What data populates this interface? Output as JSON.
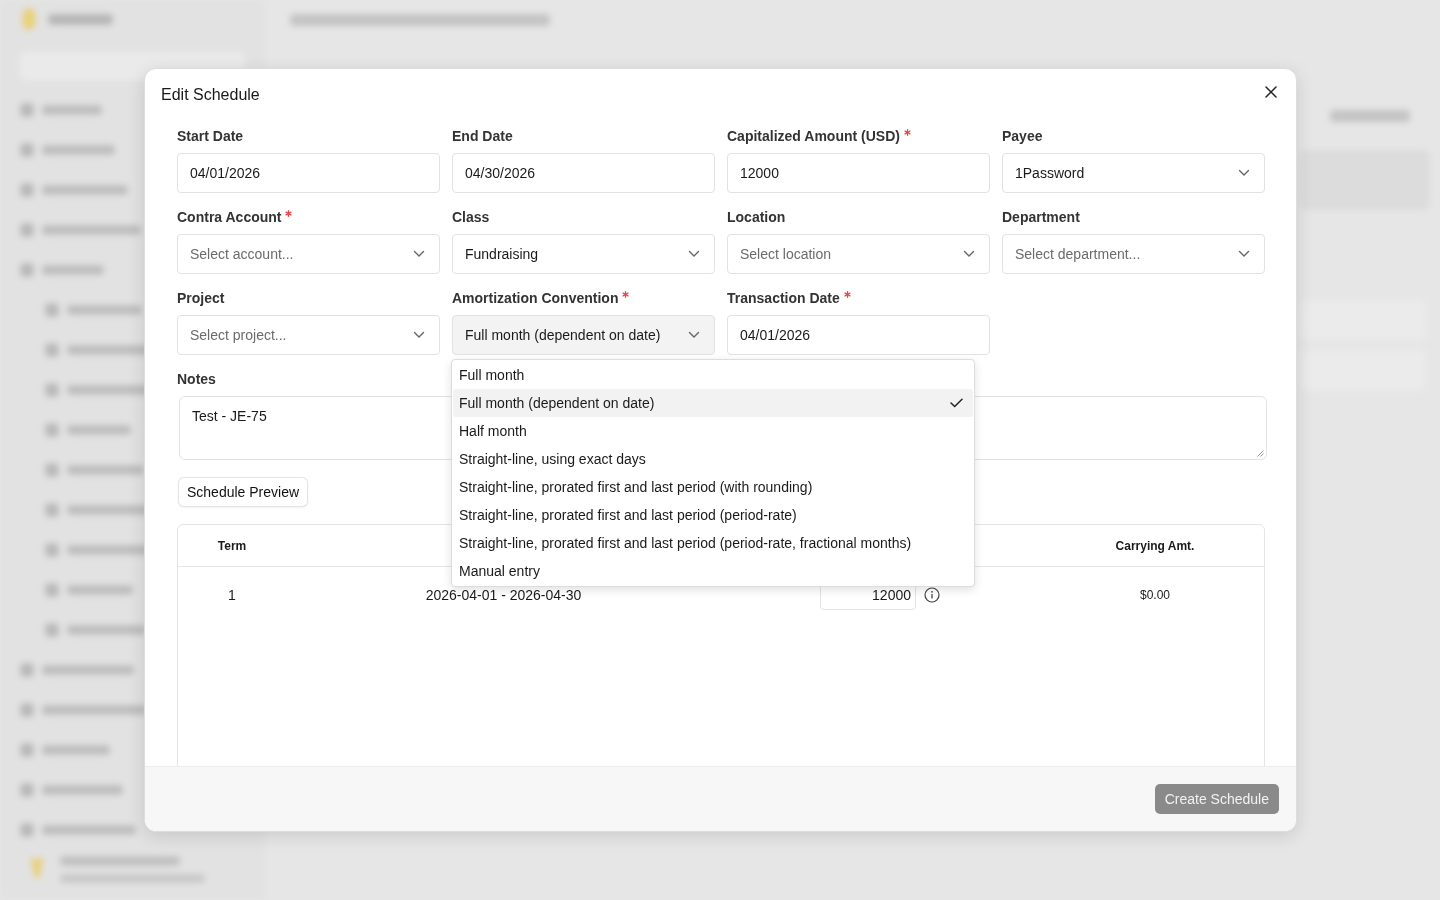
{
  "dialog": {
    "title": "Edit Schedule",
    "fields": [
      {
        "label": "Start Date",
        "required": false,
        "kind": "text",
        "value": "04/01/2026"
      },
      {
        "label": "End Date",
        "required": false,
        "kind": "text",
        "value": "04/30/2026"
      },
      {
        "label": "Capitalized Amount (USD)",
        "required": true,
        "kind": "text",
        "value": "12000"
      },
      {
        "label": "Payee",
        "required": false,
        "kind": "select",
        "value": "1Password"
      },
      {
        "label": "Contra Account",
        "required": true,
        "kind": "select",
        "placeholder": "Select account..."
      },
      {
        "label": "Class",
        "required": false,
        "kind": "select",
        "value": "Fundraising"
      },
      {
        "label": "Location",
        "required": false,
        "kind": "select",
        "placeholder": "Select location"
      },
      {
        "label": "Department",
        "required": false,
        "kind": "select",
        "placeholder": "Select department..."
      },
      {
        "label": "Project",
        "required": false,
        "kind": "select",
        "placeholder": "Select project..."
      },
      {
        "label": "Amortization Convention",
        "required": true,
        "kind": "select",
        "value": "Full month (dependent on date)",
        "open": true
      },
      {
        "label": "Transaction Date",
        "required": true,
        "kind": "text",
        "value": "04/01/2026"
      }
    ],
    "notes": {
      "label": "Notes",
      "value": "Test - JE-75"
    },
    "preview_button": "Schedule Preview",
    "table": {
      "columns": {
        "term": "Term",
        "carrying": "Carrying Amt."
      },
      "rows": [
        {
          "term": "1",
          "period": "2026-04-01 - 2026-04-30",
          "amount": "12000",
          "carrying": "$0.00"
        }
      ]
    },
    "dropdown": {
      "options": [
        {
          "label": "Full month",
          "selected": false
        },
        {
          "label": "Full month (dependent on date)",
          "selected": true
        },
        {
          "label": "Half month",
          "selected": false
        },
        {
          "label": "Straight-line, using exact days",
          "selected": false
        },
        {
          "label": "Straight-line, prorated first and last period (with rounding)",
          "selected": false
        },
        {
          "label": "Straight-line, prorated first and last period (period-rate)",
          "selected": false
        },
        {
          "label": "Straight-line, prorated first and last period (period-rate, fractional months)",
          "selected": false
        },
        {
          "label": "Manual entry",
          "selected": false
        }
      ]
    },
    "submit_button": "Create Schedule"
  }
}
